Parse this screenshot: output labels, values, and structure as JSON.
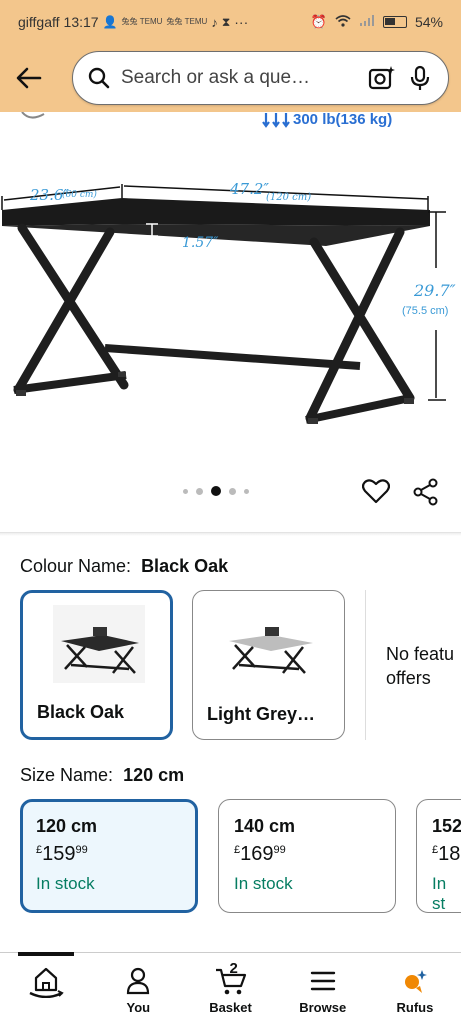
{
  "status_bar": {
    "carrier": "giffgaff",
    "time": "13:17",
    "battery": "54%",
    "tiny_labels": [
      "兔兔 TEMU",
      "兔兔 TEMU"
    ]
  },
  "search": {
    "placeholder": "Search or ask a que…"
  },
  "product_image": {
    "weight_label": "300 lb(136 kg)",
    "dim_depth": "23.6″",
    "dim_depth_cm": "(60 cm)",
    "dim_width": "47.2″",
    "dim_width_cm": "(120 cm)",
    "dim_thickness": "1.57″",
    "dim_height": "29.7″",
    "dim_height_cm": "(75.5 cm)",
    "image_count": 5,
    "active_image": 3
  },
  "colour": {
    "label": "Colour Name:",
    "selected": "Black Oak",
    "options": [
      {
        "name": "Black Oak",
        "selected": true
      },
      {
        "name": "Light Grey…",
        "selected": false
      }
    ],
    "no_featured": "No featu\noffers"
  },
  "size": {
    "label": "Size Name:",
    "selected": "120 cm",
    "options": [
      {
        "name": "120 cm",
        "currency": "£",
        "price_whole": "159",
        "price_fraction": "99",
        "stock": "In stock",
        "selected": true
      },
      {
        "name": "140 cm",
        "currency": "£",
        "price_whole": "169",
        "price_fraction": "99",
        "stock": "In stock",
        "selected": false
      },
      {
        "name": "152",
        "currency": "£",
        "price_whole": "18",
        "price_fraction": "",
        "stock": "In st",
        "selected": false
      }
    ]
  },
  "bottom_nav": {
    "items": [
      {
        "label": "",
        "icon": "home-icon"
      },
      {
        "label": "You",
        "icon": "person-icon"
      },
      {
        "label": "Basket",
        "icon": "basket-icon",
        "badge": "2"
      },
      {
        "label": "Browse",
        "icon": "menu-icon"
      },
      {
        "label": "Rufus",
        "icon": "rufus-icon"
      }
    ]
  },
  "colors": {
    "header_bg": "#f3c68c",
    "selected_border": "#2162a1",
    "in_stock": "#067d62",
    "dimension_blue": "#3a9ad6"
  }
}
